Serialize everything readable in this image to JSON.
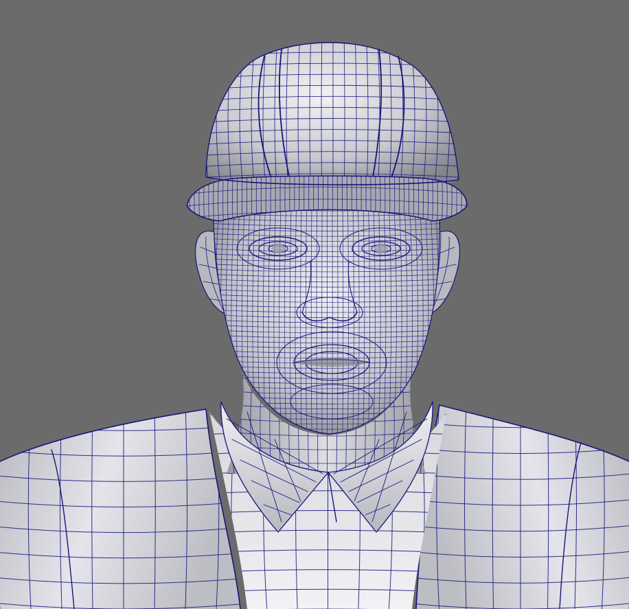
{
  "viewport": {
    "background_color": "#6b6b6b",
    "shading": "smooth-shaded-with-wireframe-on-shaded",
    "wireframe_color": "#1a1a80"
  },
  "model": {
    "subject": "construction-worker-bust",
    "parts": [
      "hard-hat",
      "head",
      "ears",
      "neck",
      "shirt-collar",
      "shirt",
      "safety-vest"
    ]
  }
}
